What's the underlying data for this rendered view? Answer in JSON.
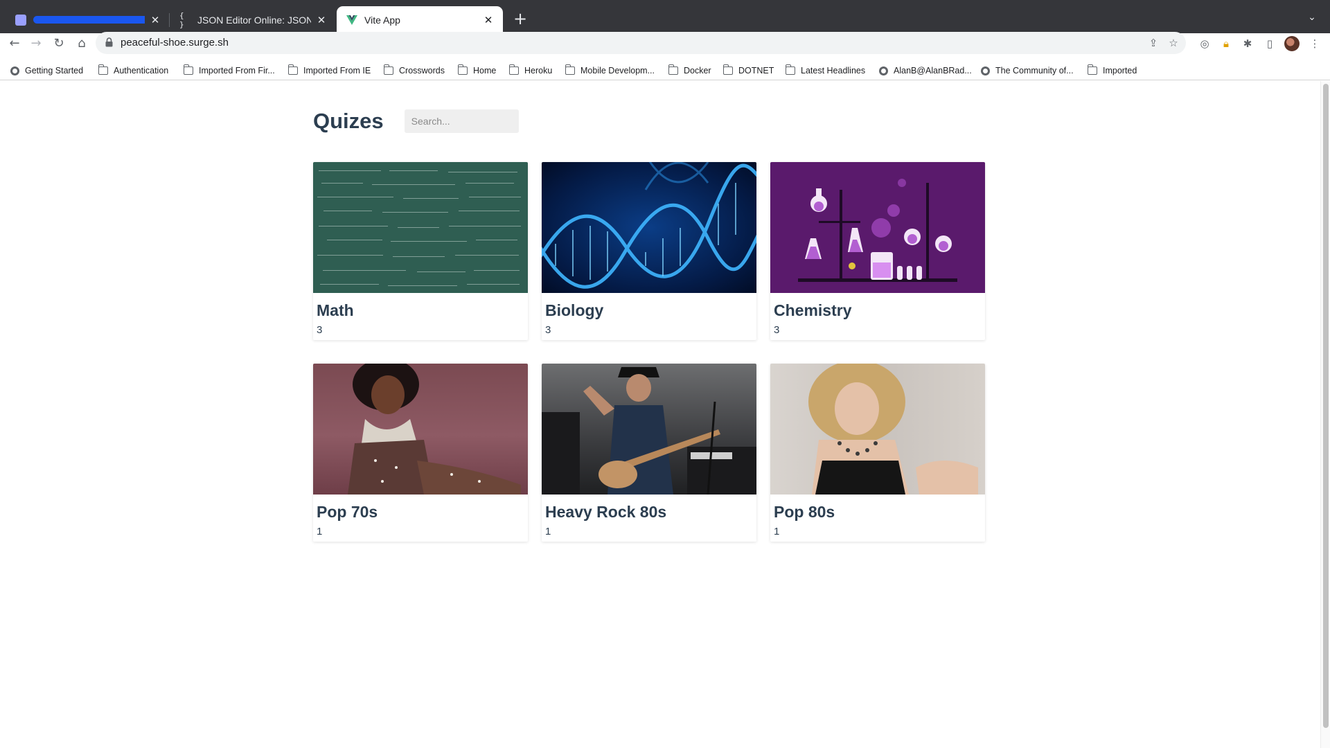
{
  "browser": {
    "tabs": [
      {
        "title": "",
        "favicon": "redacted-icon",
        "redacted": true
      },
      {
        "title": "JSON Editor Online: JSON edit",
        "favicon": "{ }"
      },
      {
        "title": "Vite App",
        "favicon": "vite-icon",
        "active": true
      }
    ],
    "url": "peaceful-shoe.surge.sh",
    "bookmarks": [
      {
        "label": "Getting Started",
        "icon": "globe-icon"
      },
      {
        "label": "Authentication",
        "icon": "folder-icon"
      },
      {
        "label": "Imported From Fir...",
        "icon": "folder-icon"
      },
      {
        "label": "Imported From IE",
        "icon": "folder-icon"
      },
      {
        "label": "Crosswords",
        "icon": "folder-icon"
      },
      {
        "label": "Home",
        "icon": "folder-icon"
      },
      {
        "label": "Heroku",
        "icon": "folder-icon"
      },
      {
        "label": "Mobile Developm...",
        "icon": "folder-icon"
      },
      {
        "label": "Docker",
        "icon": "folder-icon"
      },
      {
        "label": "DOTNET",
        "icon": "folder-icon"
      },
      {
        "label": "Latest Headlines",
        "icon": "folder-icon"
      },
      {
        "label": "AlanB@AlanBRad...",
        "icon": "globe-icon"
      },
      {
        "label": "The Community of...",
        "icon": "globe-icon"
      },
      {
        "label": "Imported",
        "icon": "folder-icon"
      }
    ]
  },
  "page": {
    "title": "Quizes",
    "search_placeholder": "Search...",
    "quizzes": [
      {
        "name": "Math",
        "count": "3"
      },
      {
        "name": "Biology",
        "count": "3"
      },
      {
        "name": "Chemistry",
        "count": "3"
      },
      {
        "name": "Pop 70s",
        "count": "1"
      },
      {
        "name": "Heavy Rock 80s",
        "count": "1"
      },
      {
        "name": "Pop 80s",
        "count": "1"
      }
    ]
  },
  "colors": {
    "heading": "#2c3e50",
    "tabstrip": "#35363a",
    "vite_green": "#41b883"
  }
}
